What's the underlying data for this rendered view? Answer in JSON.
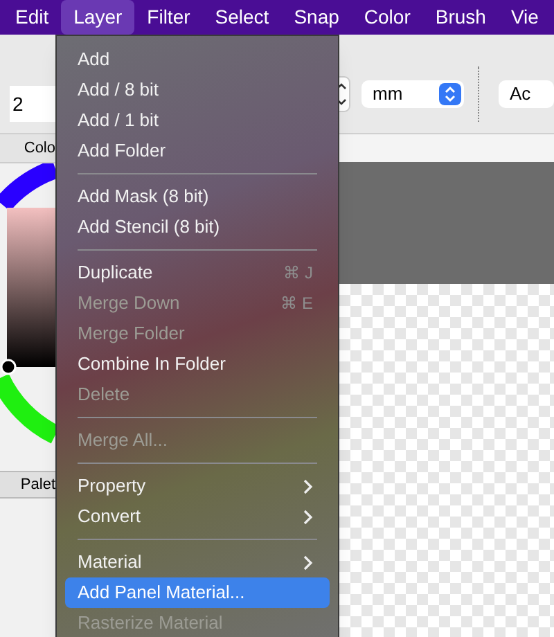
{
  "menubar": [
    {
      "label": "Edit",
      "selected": false
    },
    {
      "label": "Layer",
      "selected": true
    },
    {
      "label": "Filter",
      "selected": false
    },
    {
      "label": "Select",
      "selected": false
    },
    {
      "label": "Snap",
      "selected": false
    },
    {
      "label": "Color",
      "selected": false
    },
    {
      "label": "Brush",
      "selected": false
    },
    {
      "label": "Vie",
      "selected": false
    }
  ],
  "toolbar": {
    "size_value": "2",
    "unit": "mm",
    "button": "Ac"
  },
  "left_panel": {
    "tabs": [
      "Colo",
      "Palet"
    ]
  },
  "menu": [
    {
      "kind": "item",
      "label": "Add",
      "disabled": false,
      "selected": false
    },
    {
      "kind": "item",
      "label": "Add / 8 bit",
      "disabled": false,
      "selected": false
    },
    {
      "kind": "item",
      "label": "Add / 1 bit",
      "disabled": false,
      "selected": false
    },
    {
      "kind": "item",
      "label": "Add Folder",
      "disabled": false,
      "selected": false
    },
    {
      "kind": "separator"
    },
    {
      "kind": "item",
      "label": "Add Mask (8 bit)",
      "disabled": false,
      "selected": false
    },
    {
      "kind": "item",
      "label": "Add Stencil (8 bit)",
      "disabled": false,
      "selected": false
    },
    {
      "kind": "separator"
    },
    {
      "kind": "item",
      "label": "Duplicate",
      "shortcut": "⌘ J",
      "disabled": false,
      "selected": false
    },
    {
      "kind": "item",
      "label": "Merge Down",
      "shortcut": "⌘ E",
      "disabled": true,
      "selected": false
    },
    {
      "kind": "item",
      "label": "Merge Folder",
      "disabled": true,
      "selected": false
    },
    {
      "kind": "item",
      "label": "Combine In Folder",
      "disabled": false,
      "selected": false
    },
    {
      "kind": "item",
      "label": "Delete",
      "disabled": true,
      "selected": false
    },
    {
      "kind": "separator"
    },
    {
      "kind": "item",
      "label": "Merge All...",
      "disabled": true,
      "selected": false
    },
    {
      "kind": "separator"
    },
    {
      "kind": "item",
      "label": "Property",
      "submenu": true,
      "disabled": false,
      "selected": false
    },
    {
      "kind": "item",
      "label": "Convert",
      "submenu": true,
      "disabled": false,
      "selected": false
    },
    {
      "kind": "separator"
    },
    {
      "kind": "item",
      "label": "Material",
      "submenu": true,
      "disabled": false,
      "selected": false
    },
    {
      "kind": "item",
      "label": "Add Panel Material...",
      "disabled": false,
      "selected": true
    },
    {
      "kind": "item",
      "label": "Rasterize Material",
      "disabled": true,
      "selected": false
    }
  ]
}
